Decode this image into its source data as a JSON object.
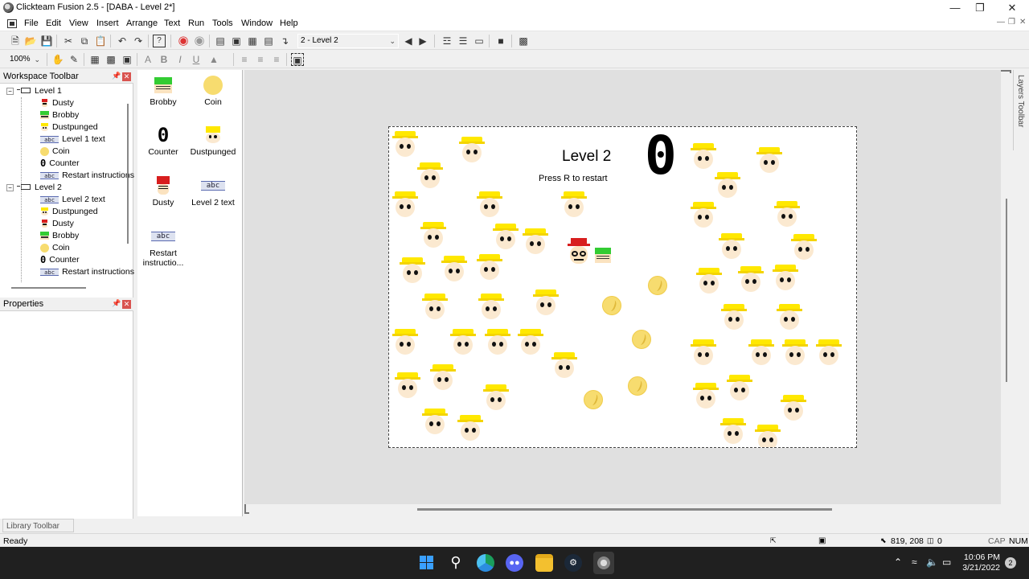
{
  "window": {
    "title": "Clickteam Fusion 2.5 - [DABA - Level 2*]",
    "minimize_icon": "minimize-icon",
    "restore_icon": "restore-icon",
    "close_icon": "close-icon"
  },
  "menubar": {
    "items": [
      "File",
      "Edit",
      "View",
      "Insert",
      "Arrange",
      "Text",
      "Run",
      "Tools",
      "Window",
      "Help"
    ]
  },
  "toolbar": {
    "frame_selector": "2 - Level 2",
    "zoom": "100%"
  },
  "workspace": {
    "title": "Workspace Toolbar",
    "tree": [
      {
        "label": "Level 1",
        "type": "frame",
        "icon": "frame-icon"
      },
      {
        "label": "Dusty",
        "type": "object",
        "icon": "dusty-icon"
      },
      {
        "label": "Brobby",
        "type": "object",
        "icon": "brobby-icon"
      },
      {
        "label": "Dustpunged",
        "type": "object",
        "icon": "dustpunged-icon"
      },
      {
        "label": "Level 1 text",
        "type": "object",
        "icon": "text-object-icon"
      },
      {
        "label": "Coin",
        "type": "object",
        "icon": "coin-icon"
      },
      {
        "label": "Counter",
        "type": "object",
        "icon": "counter-icon"
      },
      {
        "label": "Restart instructions",
        "type": "object",
        "icon": "text-object-icon"
      },
      {
        "label": "Level 2",
        "type": "frame",
        "icon": "frame-icon"
      },
      {
        "label": "Level 2 text",
        "type": "object",
        "icon": "text-object-icon"
      },
      {
        "label": "Dustpunged",
        "type": "object",
        "icon": "dustpunged-icon"
      },
      {
        "label": "Dusty",
        "type": "object",
        "icon": "dusty-icon"
      },
      {
        "label": "Brobby",
        "type": "object",
        "icon": "brobby-icon"
      },
      {
        "label": "Coin",
        "type": "object",
        "icon": "coin-icon"
      },
      {
        "label": "Counter",
        "type": "object",
        "icon": "counter-icon"
      },
      {
        "label": "Restart instructions",
        "type": "object",
        "icon": "text-object-icon"
      }
    ]
  },
  "properties": {
    "title": "Properties"
  },
  "objects_panel": {
    "items": [
      {
        "label": "Brobby",
        "icon": "brobby-icon"
      },
      {
        "label": "Coin",
        "icon": "coin-icon"
      },
      {
        "label": "Counter",
        "icon": "counter-icon"
      },
      {
        "label": "Dustpunged",
        "icon": "dustpunged-icon"
      },
      {
        "label": "Dusty",
        "icon": "dusty-icon"
      },
      {
        "label": "Level 2 text",
        "icon": "text-object-icon"
      },
      {
        "label": "Restart instructio...",
        "icon": "text-object-icon"
      }
    ]
  },
  "frame": {
    "level_text": "Level 2",
    "restart_text": "Press R to restart",
    "counter_value": "0"
  },
  "layers_tab": "Layers Toolbar",
  "library_tab": "Library Toolbar",
  "status": {
    "text": "Ready",
    "coords": "819, 208",
    "layer_count": "0",
    "caps": "CAP",
    "num": "NUM"
  },
  "taskbar": {
    "time": "10:06 PM",
    "date": "3/21/2022",
    "notification_count": "2"
  },
  "colors": {
    "hat_yellow": "#ffe800",
    "coin_gold": "#f7dc6f",
    "dusty_hat_red": "#d81e1e",
    "brobby_green": "#33cc33"
  }
}
